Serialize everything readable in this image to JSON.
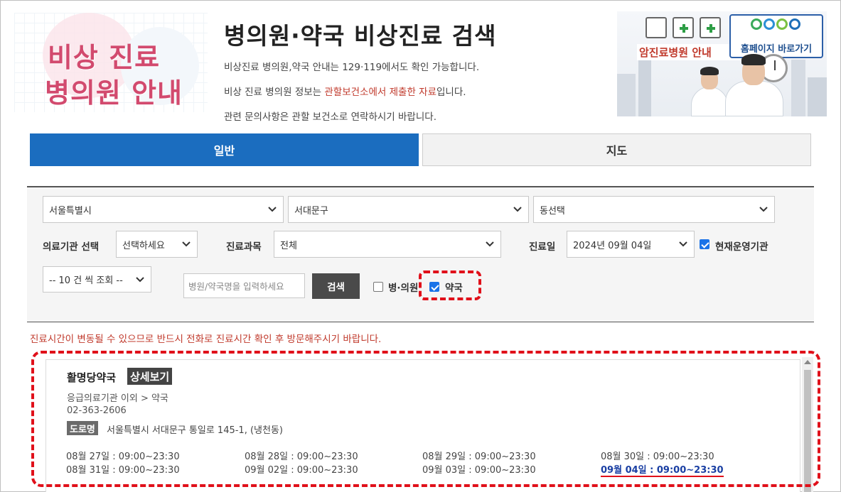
{
  "header": {
    "logo_line1": "비상 진료",
    "logo_line2": "병의원 안내",
    "title": "병의원·약국 비상진료 검색",
    "desc1": "비상진료 병의원,약국 안내는 129·119에서도 확인 가능합니다.",
    "desc2_pre": "비상 진료 병의원 정보는 ",
    "desc2_hl": "관할보건소에서 제출한 자료",
    "desc2_post": "입니다.",
    "desc3": "관련 문의사항은 관할 보건소로 연락하시기 바랍니다."
  },
  "banner": {
    "left_label": "암진료병원 안내",
    "right_label": "홈페이지 바로가기"
  },
  "tabs": [
    {
      "label": "일반",
      "active": true
    },
    {
      "label": "지도",
      "active": false
    }
  ],
  "search": {
    "city": "서울특별시",
    "district": "서대문구",
    "dong": "동선택",
    "facility_label": "의료기관 선택",
    "facility_value": "선택하세요",
    "dept_label": "진료과목",
    "dept_value": "전체",
    "date_label": "진료일",
    "date_value": "2024년 09월 04일",
    "current_label": "현재운영기관",
    "current_checked": true,
    "page_size": "-- 10 건 씩 조회 --",
    "name_placeholder": "병원/약국명을 입력하세요",
    "search_button": "검색",
    "hospital_label": "병·의원",
    "hospital_checked": false,
    "pharmacy_label": "약국",
    "pharmacy_checked": true
  },
  "notice": "진료시간이 변동될 수 있으므로 반드시 전화로 진료시간 확인 후 방문해주시기 바랍니다.",
  "result": {
    "name": "활명당약국",
    "detail_button": "상세보기",
    "category": "응급의료기관 이외 > 약국",
    "tel": "02-363-2606",
    "road_badge": "도로명",
    "address": "서울특별시 서대문구 통일로 145-1, (냉천동)",
    "schedule": [
      "08월 27일 : 09:00~23:30",
      "08월 28일 : 09:00~23:30",
      "08월 29일 : 09:00~23:30",
      "08월 30일 : 09:00~23:30",
      "08월 31일 : 09:00~23:30",
      "09월 02일 : 09:00~23:30",
      "09월 03일 : 09:00~23:30",
      "09월 04일 : 09:00~23:30"
    ]
  },
  "colors": {
    "accent_blue": "#1b6dbf",
    "highlight_red": "#e0101a",
    "logo_pink": "#d24a6e"
  }
}
